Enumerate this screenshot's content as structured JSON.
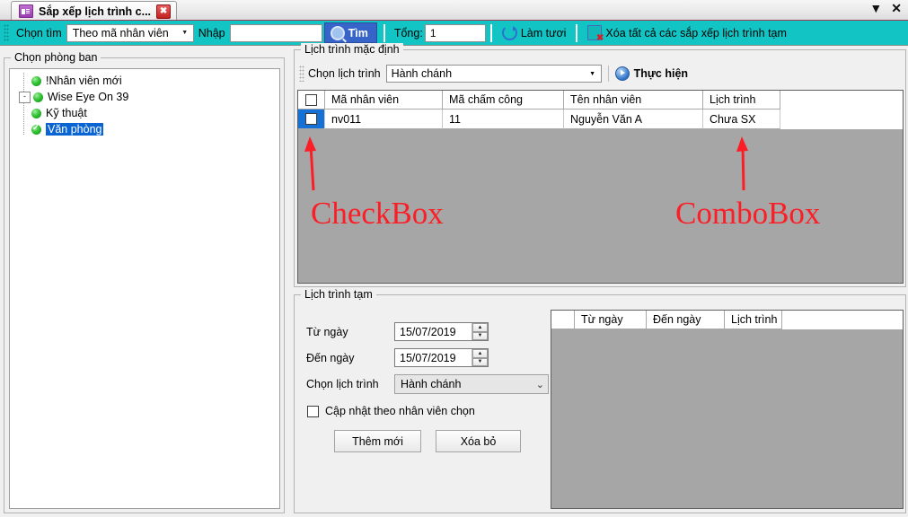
{
  "window": {
    "tab_title": "Sắp xếp lịch trình c...",
    "tab_icon": "window-purple-icon",
    "close_label": "✖",
    "dropdown_label": "▼",
    "win_close_label": "✕"
  },
  "toolbar": {
    "search_by_label": "Chọn tìm",
    "search_by_value": "Theo mã nhân viên",
    "input_label": "Nhập",
    "input_value": "",
    "find_button": "Tìm",
    "total_label": "Tổng:",
    "total_value": "1",
    "refresh_button": "Làm tươi",
    "delete_all_button": "Xóa tất cả các sắp xếp lịch trình tạm"
  },
  "left_panel": {
    "title": "Chọn phòng ban",
    "tree": [
      {
        "label": "!Nhân viên mới",
        "level": 0,
        "expander": "",
        "checked": false,
        "selected": false
      },
      {
        "label": "Wise Eye On 39",
        "level": 0,
        "expander": "-",
        "checked": false,
        "selected": false
      },
      {
        "label": "Kỹ thuật",
        "level": 1,
        "expander": "",
        "checked": false,
        "selected": false
      },
      {
        "label": "Văn phòng",
        "level": 1,
        "expander": "",
        "checked": true,
        "selected": true
      }
    ]
  },
  "default_schedule": {
    "title": "Lịch trình mặc định",
    "choose_label": "Chọn lịch trình",
    "choose_value": "Hành chánh",
    "execute_button": "Thực hiện",
    "grid": {
      "columns": [
        "",
        "Mã nhân viên",
        "Mã chấm công",
        "Tên nhân viên",
        "Lịch trình"
      ],
      "rows": [
        {
          "checked": false,
          "cells": [
            "nv011",
            "11",
            "Nguyễn Văn A",
            "Chưa SX"
          ]
        }
      ]
    }
  },
  "temp_schedule": {
    "title": "Lịch trình tạm",
    "from_label": "Từ ngày",
    "from_value": "15/07/2019",
    "to_label": "Đến ngày",
    "to_value": "15/07/2019",
    "choose_label": "Chọn lịch trình",
    "choose_value": "Hành chánh",
    "update_checkbox_label": "Cập nhật theo nhân viên chọn",
    "add_button": "Thêm mới",
    "delete_button": "Xóa bỏ",
    "grid": {
      "columns": [
        "",
        "Từ ngày",
        "Đến ngày",
        "Lịch trình"
      ],
      "rows": []
    }
  },
  "annotations": [
    {
      "text": "CheckBox"
    },
    {
      "text": "ComboBox"
    }
  ],
  "colors": {
    "toolbar": "#12c4c4",
    "accent_blue": "#3664c8",
    "selection_blue": "#0a64d2",
    "grid_empty": "#a6a6a6",
    "annotation_red": "#fc1e26"
  }
}
